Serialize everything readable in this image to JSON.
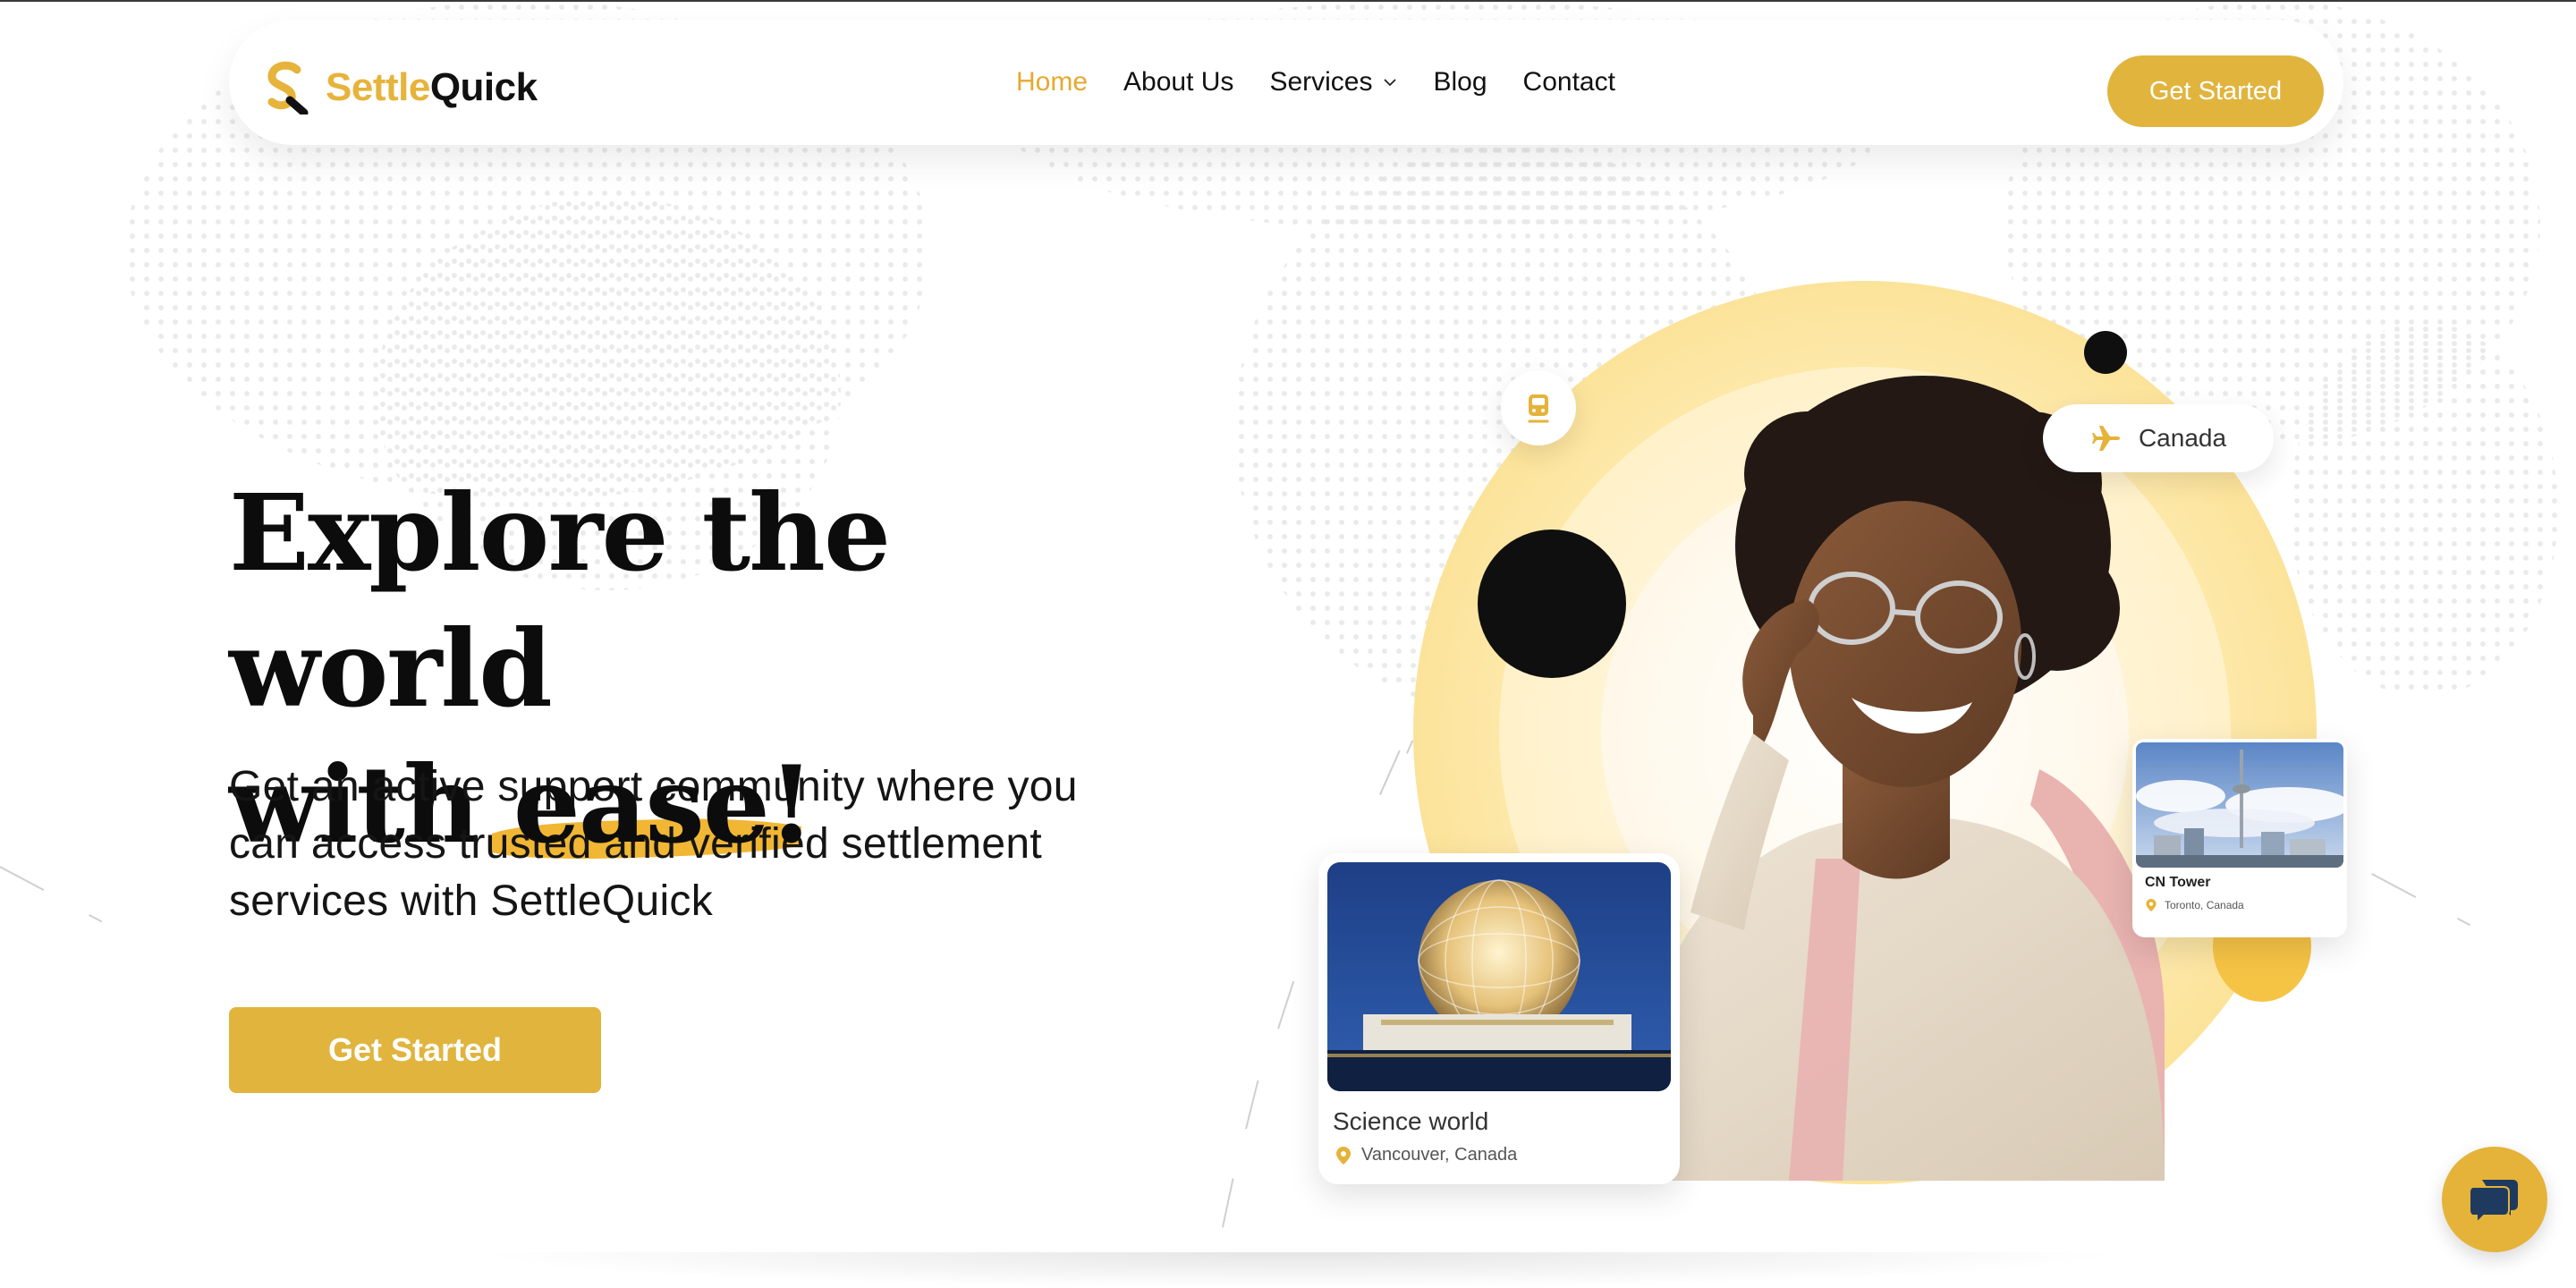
{
  "brand": {
    "name_part1": "Settle",
    "name_part2": "Quick",
    "accent_color": "#e1b43d",
    "logo_icon": "settlequick-logo-icon"
  },
  "nav": {
    "items": [
      {
        "label": "Home",
        "active": true
      },
      {
        "label": "About Us",
        "active": false
      },
      {
        "label": "Services",
        "active": false,
        "has_dropdown": true
      },
      {
        "label": "Blog",
        "active": false
      },
      {
        "label": "Contact",
        "active": false
      }
    ],
    "cta_label": "Get Started"
  },
  "hero": {
    "headline_line1": "Explore the world",
    "headline_line2_prefix": "with",
    "headline_highlight": "ease!",
    "lead": "Get an active support community where you can access trusted and verified settlement services with SettleQuick",
    "cta_label": "Get Started"
  },
  "badges": {
    "destination_label": "Canada",
    "destination_icon": "airplane-icon",
    "transit_icon": "train-icon"
  },
  "cards": [
    {
      "title": "Science world",
      "location": "Vancouver, Canada",
      "icon": "location-pin-icon"
    },
    {
      "title": "CN Tower",
      "location": "Toronto, Canada",
      "icon": "location-pin-icon"
    }
  ],
  "chat": {
    "icon": "chat-bubbles-icon"
  }
}
